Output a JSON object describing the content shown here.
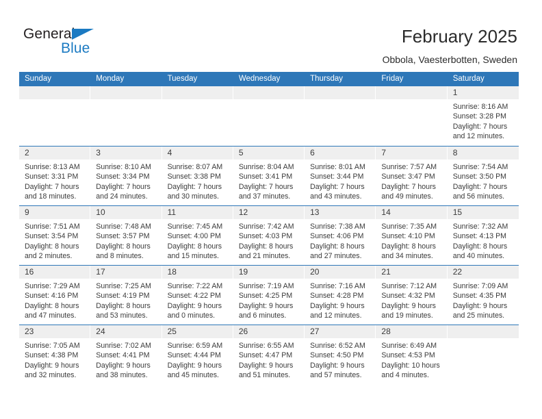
{
  "brand": {
    "name_part1": "General",
    "name_part2": "Blue",
    "triangle_icon": "triangle-icon",
    "color_dark": "#231f20",
    "color_blue": "#1b7ac2"
  },
  "header": {
    "title": "February 2025",
    "subtitle": "Obbola, Vaesterbotten, Sweden"
  },
  "theme": {
    "header_bar_color": "#2e77b8",
    "day_band_color": "#efefef",
    "row_divider_color": "#2e77b8",
    "text_color": "#3a3a3a"
  },
  "weekdays": [
    "Sunday",
    "Monday",
    "Tuesday",
    "Wednesday",
    "Thursday",
    "Friday",
    "Saturday"
  ],
  "weeks": [
    [
      {
        "day": "",
        "lines": []
      },
      {
        "day": "",
        "lines": []
      },
      {
        "day": "",
        "lines": []
      },
      {
        "day": "",
        "lines": []
      },
      {
        "day": "",
        "lines": []
      },
      {
        "day": "",
        "lines": []
      },
      {
        "day": "1",
        "lines": [
          "Sunrise: 8:16 AM",
          "Sunset: 3:28 PM",
          "Daylight: 7 hours",
          "and 12 minutes."
        ]
      }
    ],
    [
      {
        "day": "2",
        "lines": [
          "Sunrise: 8:13 AM",
          "Sunset: 3:31 PM",
          "Daylight: 7 hours",
          "and 18 minutes."
        ]
      },
      {
        "day": "3",
        "lines": [
          "Sunrise: 8:10 AM",
          "Sunset: 3:34 PM",
          "Daylight: 7 hours",
          "and 24 minutes."
        ]
      },
      {
        "day": "4",
        "lines": [
          "Sunrise: 8:07 AM",
          "Sunset: 3:38 PM",
          "Daylight: 7 hours",
          "and 30 minutes."
        ]
      },
      {
        "day": "5",
        "lines": [
          "Sunrise: 8:04 AM",
          "Sunset: 3:41 PM",
          "Daylight: 7 hours",
          "and 37 minutes."
        ]
      },
      {
        "day": "6",
        "lines": [
          "Sunrise: 8:01 AM",
          "Sunset: 3:44 PM",
          "Daylight: 7 hours",
          "and 43 minutes."
        ]
      },
      {
        "day": "7",
        "lines": [
          "Sunrise: 7:57 AM",
          "Sunset: 3:47 PM",
          "Daylight: 7 hours",
          "and 49 minutes."
        ]
      },
      {
        "day": "8",
        "lines": [
          "Sunrise: 7:54 AM",
          "Sunset: 3:50 PM",
          "Daylight: 7 hours",
          "and 56 minutes."
        ]
      }
    ],
    [
      {
        "day": "9",
        "lines": [
          "Sunrise: 7:51 AM",
          "Sunset: 3:54 PM",
          "Daylight: 8 hours",
          "and 2 minutes."
        ]
      },
      {
        "day": "10",
        "lines": [
          "Sunrise: 7:48 AM",
          "Sunset: 3:57 PM",
          "Daylight: 8 hours",
          "and 8 minutes."
        ]
      },
      {
        "day": "11",
        "lines": [
          "Sunrise: 7:45 AM",
          "Sunset: 4:00 PM",
          "Daylight: 8 hours",
          "and 15 minutes."
        ]
      },
      {
        "day": "12",
        "lines": [
          "Sunrise: 7:42 AM",
          "Sunset: 4:03 PM",
          "Daylight: 8 hours",
          "and 21 minutes."
        ]
      },
      {
        "day": "13",
        "lines": [
          "Sunrise: 7:38 AM",
          "Sunset: 4:06 PM",
          "Daylight: 8 hours",
          "and 27 minutes."
        ]
      },
      {
        "day": "14",
        "lines": [
          "Sunrise: 7:35 AM",
          "Sunset: 4:10 PM",
          "Daylight: 8 hours",
          "and 34 minutes."
        ]
      },
      {
        "day": "15",
        "lines": [
          "Sunrise: 7:32 AM",
          "Sunset: 4:13 PM",
          "Daylight: 8 hours",
          "and 40 minutes."
        ]
      }
    ],
    [
      {
        "day": "16",
        "lines": [
          "Sunrise: 7:29 AM",
          "Sunset: 4:16 PM",
          "Daylight: 8 hours",
          "and 47 minutes."
        ]
      },
      {
        "day": "17",
        "lines": [
          "Sunrise: 7:25 AM",
          "Sunset: 4:19 PM",
          "Daylight: 8 hours",
          "and 53 minutes."
        ]
      },
      {
        "day": "18",
        "lines": [
          "Sunrise: 7:22 AM",
          "Sunset: 4:22 PM",
          "Daylight: 9 hours",
          "and 0 minutes."
        ]
      },
      {
        "day": "19",
        "lines": [
          "Sunrise: 7:19 AM",
          "Sunset: 4:25 PM",
          "Daylight: 9 hours",
          "and 6 minutes."
        ]
      },
      {
        "day": "20",
        "lines": [
          "Sunrise: 7:16 AM",
          "Sunset: 4:28 PM",
          "Daylight: 9 hours",
          "and 12 minutes."
        ]
      },
      {
        "day": "21",
        "lines": [
          "Sunrise: 7:12 AM",
          "Sunset: 4:32 PM",
          "Daylight: 9 hours",
          "and 19 minutes."
        ]
      },
      {
        "day": "22",
        "lines": [
          "Sunrise: 7:09 AM",
          "Sunset: 4:35 PM",
          "Daylight: 9 hours",
          "and 25 minutes."
        ]
      }
    ],
    [
      {
        "day": "23",
        "lines": [
          "Sunrise: 7:05 AM",
          "Sunset: 4:38 PM",
          "Daylight: 9 hours",
          "and 32 minutes."
        ]
      },
      {
        "day": "24",
        "lines": [
          "Sunrise: 7:02 AM",
          "Sunset: 4:41 PM",
          "Daylight: 9 hours",
          "and 38 minutes."
        ]
      },
      {
        "day": "25",
        "lines": [
          "Sunrise: 6:59 AM",
          "Sunset: 4:44 PM",
          "Daylight: 9 hours",
          "and 45 minutes."
        ]
      },
      {
        "day": "26",
        "lines": [
          "Sunrise: 6:55 AM",
          "Sunset: 4:47 PM",
          "Daylight: 9 hours",
          "and 51 minutes."
        ]
      },
      {
        "day": "27",
        "lines": [
          "Sunrise: 6:52 AM",
          "Sunset: 4:50 PM",
          "Daylight: 9 hours",
          "and 57 minutes."
        ]
      },
      {
        "day": "28",
        "lines": [
          "Sunrise: 6:49 AM",
          "Sunset: 4:53 PM",
          "Daylight: 10 hours",
          "and 4 minutes."
        ]
      },
      {
        "day": "",
        "lines": []
      }
    ]
  ]
}
